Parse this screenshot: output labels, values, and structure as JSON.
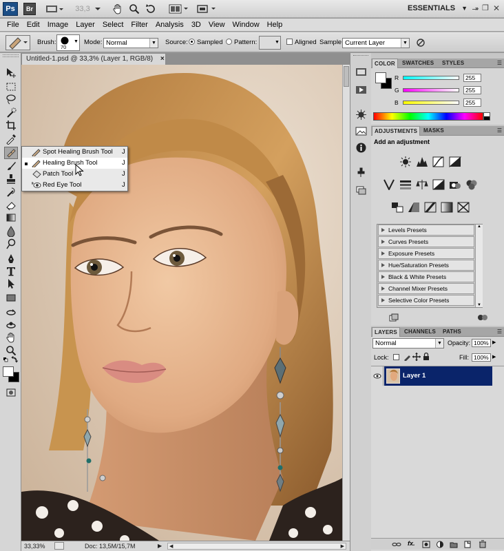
{
  "appbar": {
    "ps_logo": "Ps",
    "br_logo": "Br",
    "zoom": "33,3",
    "workspace": "ESSENTIALS",
    "minimize": "–",
    "restore": "❐",
    "close": "✕"
  },
  "menu": [
    "File",
    "Edit",
    "Image",
    "Layer",
    "Select",
    "Filter",
    "Analysis",
    "3D",
    "View",
    "Window",
    "Help"
  ],
  "options": {
    "brush_label": "Brush:",
    "brush_size": "70",
    "mode_label": "Mode:",
    "mode_value": "Normal",
    "source_label": "Source:",
    "sampled_label": "Sampled",
    "pattern_label": "Pattern:",
    "aligned_label": "Aligned",
    "sample_label": "Sample:",
    "sample_value": "Current Layer"
  },
  "document": {
    "tab_title": "Untitled-1.psd @ 33,3% (Layer 1, RGB/8)",
    "close_x": "×"
  },
  "status": {
    "zoom": "33,33%",
    "doc_info": "Doc: 13,5M/15,7M"
  },
  "flyout": {
    "items": [
      {
        "label": "Spot Healing Brush Tool",
        "key": "J"
      },
      {
        "label": "Healing Brush Tool",
        "key": "J"
      },
      {
        "label": "Patch Tool",
        "key": "J"
      },
      {
        "label": "Red Eye Tool",
        "key": "J"
      }
    ]
  },
  "color_panel": {
    "tabs": [
      "COLOR",
      "SWATCHES",
      "STYLES"
    ],
    "r_label": "R",
    "r_value": "255",
    "g_label": "G",
    "g_value": "255",
    "b_label": "B",
    "b_value": "255"
  },
  "adjust_panel": {
    "tabs": [
      "ADJUSTMENTS",
      "MASKS"
    ],
    "heading": "Add an adjustment",
    "presets": [
      "Levels Presets",
      "Curves Presets",
      "Exposure Presets",
      "Hue/Saturation Presets",
      "Black & White Presets",
      "Channel Mixer Presets",
      "Selective Color Presets"
    ]
  },
  "layers_panel": {
    "tabs": [
      "LAYERS",
      "CHANNELS",
      "PATHS"
    ],
    "blend": "Normal",
    "opacity_label": "Opacity:",
    "opacity_value": "100%",
    "lock_label": "Lock:",
    "fill_label": "Fill:",
    "fill_value": "100%",
    "layer_name": "Layer 1"
  },
  "colors": {
    "selected_layer": "#0a246a",
    "doc_bg": "#dcc8b2",
    "ps_blue": "#1c4e86"
  }
}
